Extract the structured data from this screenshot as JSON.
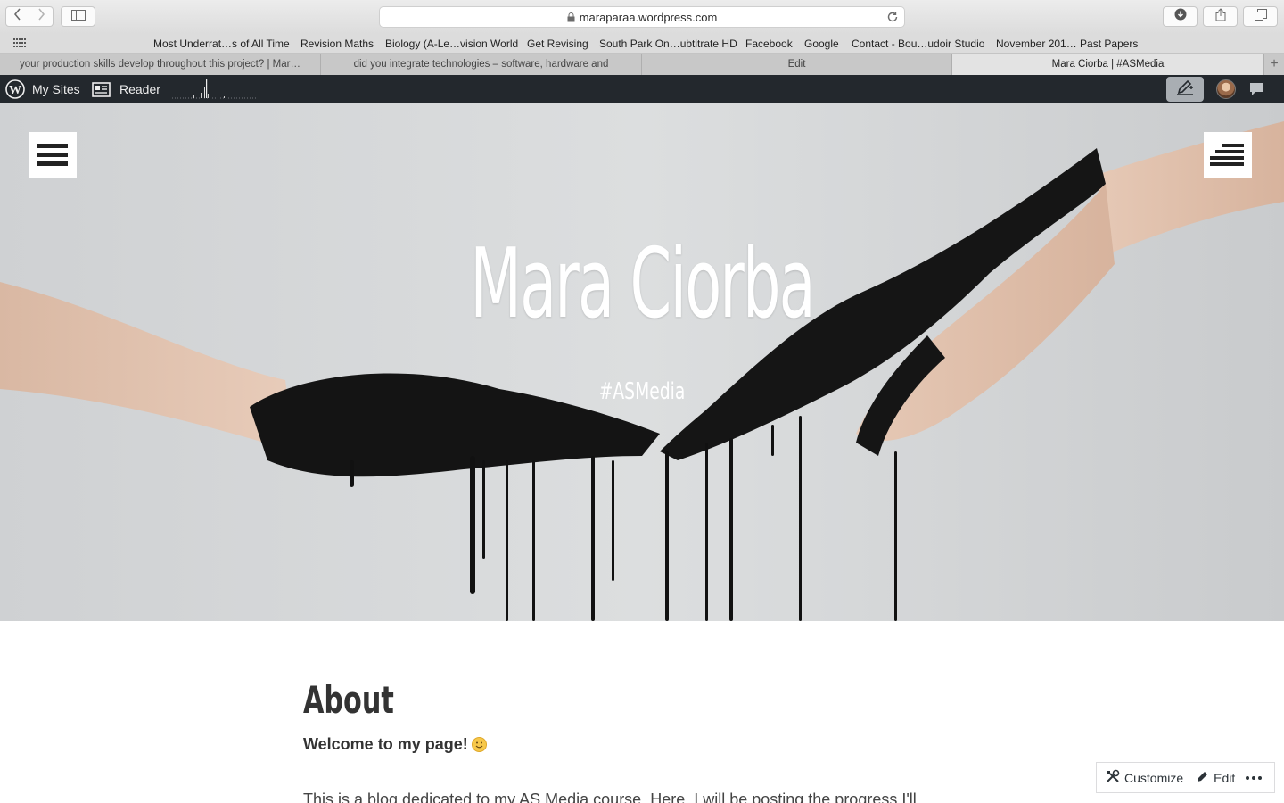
{
  "browser": {
    "url": "maraparaa.wordpress.com",
    "favorites": [
      "Most Underrat…s of All Time",
      "Revision Maths",
      "Biology (A-Le…vision World",
      "Get Revising",
      "South Park On…ubtitrate HD",
      "Facebook",
      "Google",
      "Contact - Bou…udoir Studio",
      "November 201… Past Papers"
    ],
    "tabs": [
      "your production skills develop throughout this project? | Mar…",
      "did you integrate technologies – software, hardware and",
      "Edit",
      "Mara Ciorba | #ASMedia"
    ],
    "active_tab_index": 3
  },
  "admin_bar": {
    "my_sites_label": "My Sites",
    "reader_label": "Reader"
  },
  "hero": {
    "site_title": "Mara Ciorba",
    "tagline": "#ASMedia"
  },
  "page": {
    "heading": "About",
    "welcome": "Welcome to my page!",
    "intro": "This is a blog dedicated to my AS Media course. Here, I will be posting the progress I'll"
  },
  "customize_bar": {
    "customize_label": "Customize",
    "edit_label": "Edit"
  },
  "colors": {
    "admin_bar_bg": "#23282d",
    "hero_bg": "#d6d8da",
    "text": "#333333"
  }
}
